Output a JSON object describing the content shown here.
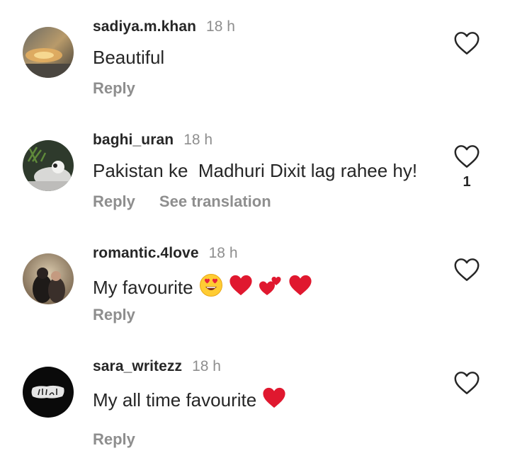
{
  "comments": [
    {
      "username": "sadiya.m.khan",
      "time": "18 h",
      "text": "Beautiful",
      "reply_label": "Reply",
      "likes": ""
    },
    {
      "username": "baghi_uran",
      "time": "18 h",
      "text": "Pakistan ke  Madhuri Dixit lag rahee hy!",
      "reply_label": "Reply",
      "translation_label": "See translation",
      "likes": "1"
    },
    {
      "username": "romantic.4love",
      "time": "18 h",
      "text": "My favourite",
      "emojis": [
        "heart-eyes-emoji",
        "red-heart-emoji",
        "two-hearts-emoji",
        "red-heart-emoji"
      ],
      "reply_label": "Reply",
      "likes": ""
    },
    {
      "username": "sara_writezz",
      "time": "18 h",
      "text": "My all time favourite",
      "emojis": [
        "red-heart-emoji"
      ],
      "reply_label": "Reply",
      "likes": ""
    }
  ],
  "colors": {
    "text": "#262626",
    "secondary": "#8e8e8e",
    "heart_emoji": "#e0182f"
  }
}
